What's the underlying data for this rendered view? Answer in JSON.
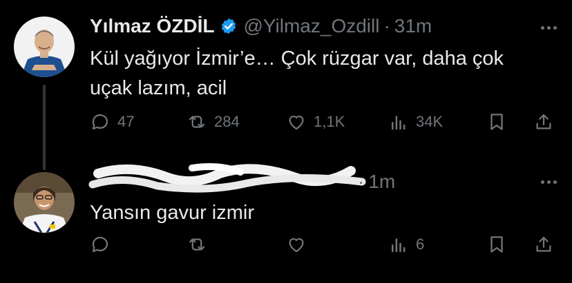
{
  "tweets": [
    {
      "author_name": "Yılmaz ÖZDİL",
      "handle": "@Yilmaz_Ozdill",
      "separator": "·",
      "time": "31m",
      "text_line1": "Kül yağıyor İzmir’e… Çok rüzgar var, daha çok",
      "text_line2": "uçak lazım, acil",
      "replies": "47",
      "reposts": "284",
      "likes": "1,1K",
      "views": "34K"
    },
    {
      "author_name": "",
      "handle": "",
      "separator": "·",
      "time": "1m",
      "text_line1": "Yansın gavur izmir",
      "replies": "",
      "reposts": "",
      "likes": "",
      "views": "6"
    }
  ],
  "colors": {
    "background": "#000000",
    "text": "#e7e9ea",
    "muted": "#71767b",
    "verified": "#1d9bf0"
  },
  "icons": [
    "reply-icon",
    "repost-icon",
    "like-icon",
    "views-icon",
    "bookmark-icon",
    "share-icon",
    "more-icon",
    "verified-icon"
  ]
}
